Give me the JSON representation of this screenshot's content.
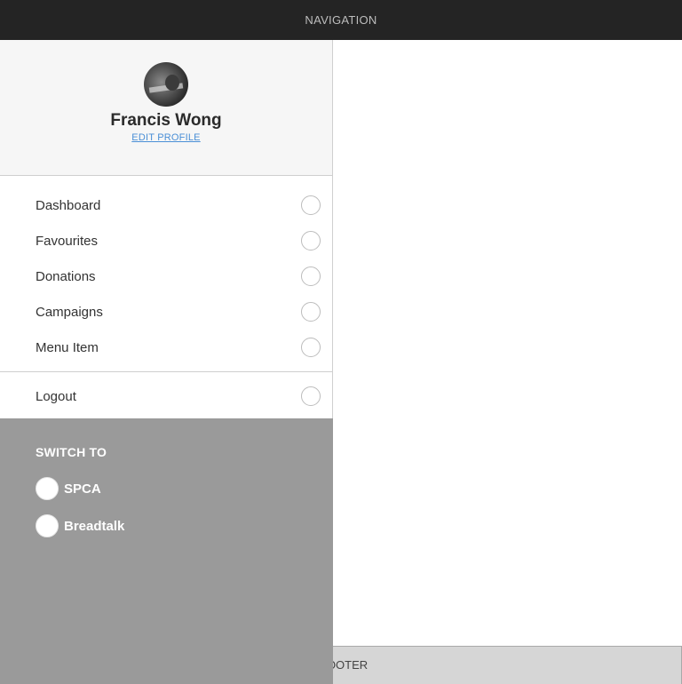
{
  "header": {
    "title": "NAVIGATION"
  },
  "footer": {
    "label": "FOOTER"
  },
  "profile": {
    "name": "Francis Wong",
    "edit_label": "EDIT PROFILE"
  },
  "menu": {
    "items": [
      {
        "label": "Dashboard"
      },
      {
        "label": "Favourites"
      },
      {
        "label": "Donations"
      },
      {
        "label": "Campaigns"
      },
      {
        "label": "Menu Item"
      }
    ],
    "logout": "Logout"
  },
  "switch_to": {
    "title": "SWITCH TO",
    "options": [
      {
        "label": "SPCA"
      },
      {
        "label": "Breadtalk"
      }
    ]
  },
  "colors": {
    "topbar": "#242424",
    "drawer_profile_bg": "#f6f6f6",
    "switch_bg": "#9a9a9a",
    "link": "#4a8fd6",
    "footer_bg": "#d6d6d6"
  }
}
